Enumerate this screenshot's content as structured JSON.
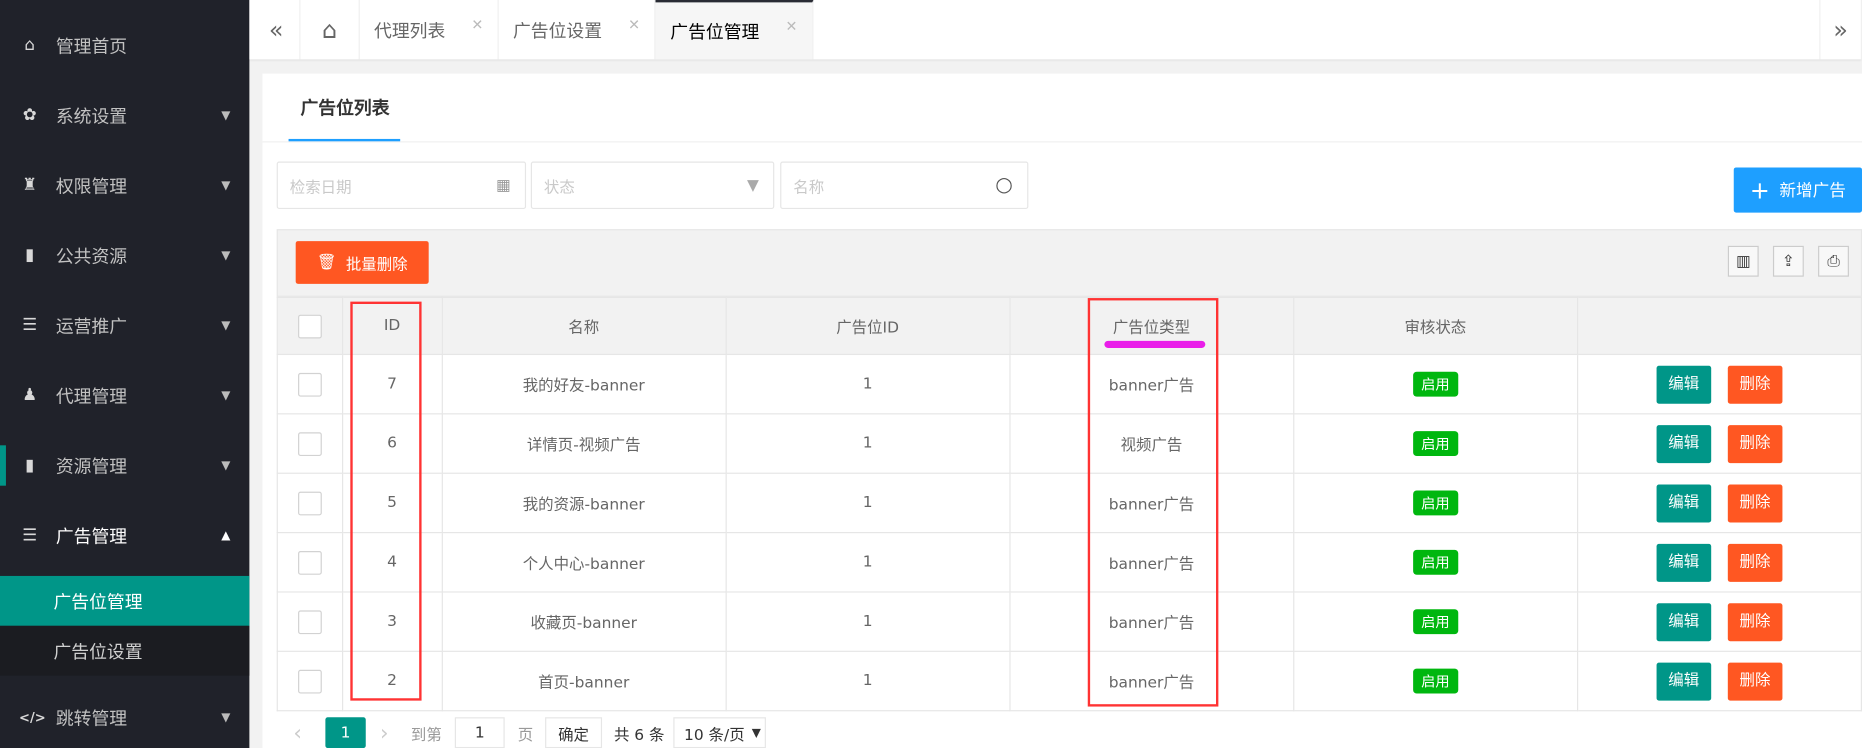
{
  "sidebar": {
    "items": [
      {
        "label": "管理首页",
        "icon": "home-icon"
      },
      {
        "label": "系统设置",
        "icon": "gear-icon"
      },
      {
        "label": "权限管理",
        "icon": "user-key-icon"
      },
      {
        "label": "公共资源",
        "icon": "bookmark-icon"
      },
      {
        "label": "运营推广",
        "icon": "list-icon"
      },
      {
        "label": "代理管理",
        "icon": "user-icon"
      },
      {
        "label": "资源管理",
        "icon": "bookmark-icon"
      },
      {
        "label": "广告管理",
        "icon": "list-icon"
      },
      {
        "label": "跳转管理",
        "icon": "code-icon"
      }
    ],
    "subitems": [
      {
        "label": "广告位管理"
      },
      {
        "label": "广告位设置"
      }
    ]
  },
  "tabs": [
    {
      "label": "代理列表"
    },
    {
      "label": "广告位设置"
    },
    {
      "label": "广告位管理"
    }
  ],
  "card": {
    "title": "广告位列表"
  },
  "filters": {
    "date_placeholder": "检索日期",
    "status_placeholder": "状态",
    "name_placeholder": "名称"
  },
  "add_button": "新增广告",
  "batch_delete": "批量删除",
  "table": {
    "headers": [
      "ID",
      "名称",
      "广告位ID",
      "广告位类型",
      "审核状态",
      ""
    ],
    "rows": [
      {
        "id": "7",
        "name": "我的好友-banner",
        "slot_id": "1",
        "type": "banner广告",
        "status": "启用"
      },
      {
        "id": "6",
        "name": "详情页-视频广告",
        "slot_id": "1",
        "type": "视频广告",
        "status": "启用"
      },
      {
        "id": "5",
        "name": "我的资源-banner",
        "slot_id": "1",
        "type": "banner广告",
        "status": "启用"
      },
      {
        "id": "4",
        "name": "个人中心-banner",
        "slot_id": "1",
        "type": "banner广告",
        "status": "启用"
      },
      {
        "id": "3",
        "name": "收藏页-banner",
        "slot_id": "1",
        "type": "banner广告",
        "status": "启用"
      },
      {
        "id": "2",
        "name": "首页-banner",
        "slot_id": "1",
        "type": "banner广告",
        "status": "启用"
      }
    ],
    "edit_label": "编辑",
    "delete_label": "删除"
  },
  "pagination": {
    "current": "1",
    "goto_label": "到第",
    "goto_value": "1",
    "page_label": "页",
    "confirm": "确定",
    "total": "共 6 条",
    "page_size": "10 条/页"
  },
  "colors": {
    "sidebar": "#20222a",
    "teal": "#009688",
    "orange": "#ff5722",
    "blue": "#1e9fff",
    "green": "#00b70f",
    "annotation_red": "#ff3333",
    "annotation_magenta": "#e91ee9"
  }
}
